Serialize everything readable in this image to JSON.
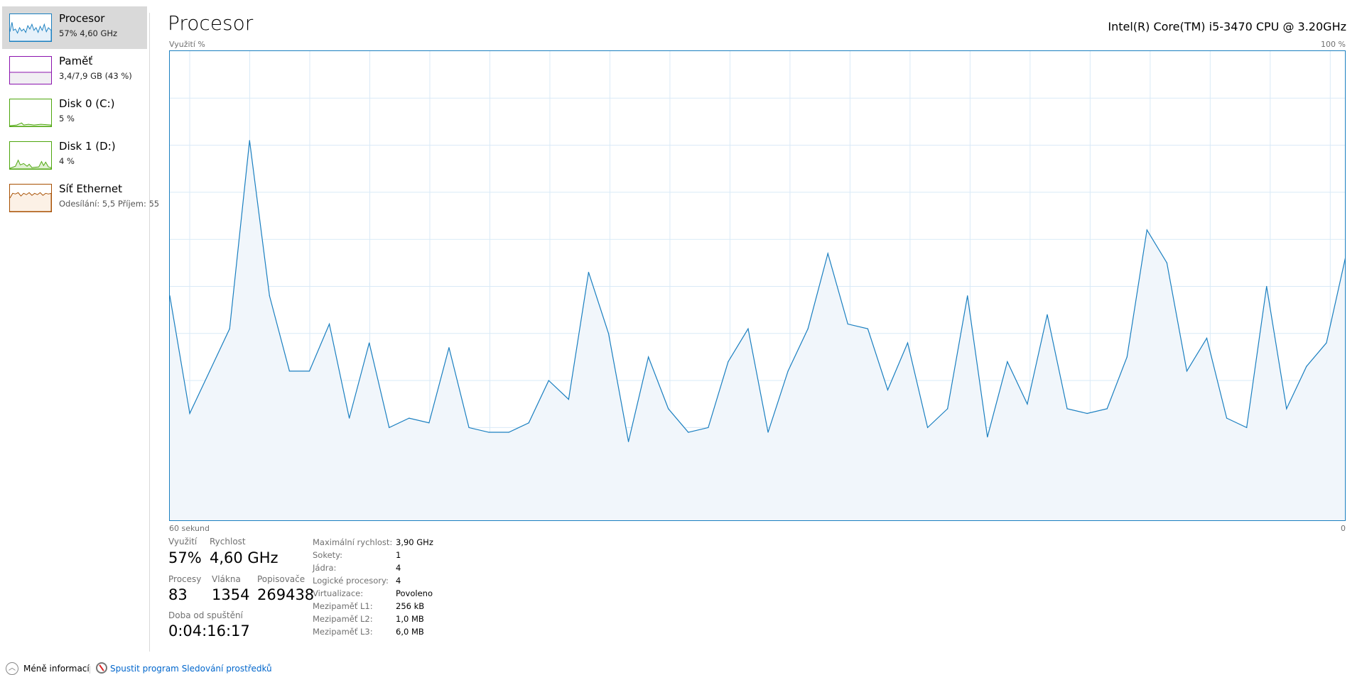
{
  "sidebar": {
    "items": [
      {
        "title": "Procesor",
        "sub": "57% 4,60 GHz",
        "color": "#1a7fc0"
      },
      {
        "title": "Paměť",
        "sub": "3,4/7,9 GB (43 %)",
        "color": "#8b12ae"
      },
      {
        "title": "Disk 0 (C:)",
        "sub": "5 %",
        "color": "#4da60c"
      },
      {
        "title": "Disk 1 (D:)",
        "sub": "4 %",
        "color": "#4da60c"
      },
      {
        "title": "Síť Ethernet",
        "sub": "Odesílání: 5,5 Příjem: 55",
        "color": "#a74f01"
      }
    ]
  },
  "header": {
    "title": "Procesor",
    "cpu_name": "Intel(R) Core(TM) i5-3470 CPU @ 3.20GHz"
  },
  "chart_data": {
    "type": "area",
    "ylabel": "Využití %",
    "ymax_label": "100 %",
    "xlabel_left": "60 sekund",
    "xlabel_right": "0",
    "ylim": [
      0,
      100
    ],
    "values": [
      48,
      23,
      32,
      41,
      81,
      48,
      32,
      32,
      42,
      22,
      38,
      20,
      22,
      21,
      37,
      20,
      19,
      19,
      21,
      30,
      26,
      53,
      40,
      17,
      35,
      24,
      19,
      20,
      34,
      41,
      19,
      32,
      41,
      57,
      42,
      41,
      28,
      38,
      20,
      24,
      48,
      18,
      34,
      25,
      44,
      24,
      23,
      24,
      35,
      62,
      55,
      32,
      39,
      22,
      20,
      50,
      24,
      33,
      38,
      57
    ]
  },
  "stats": {
    "util_label": "Využití",
    "util": "57%",
    "speed_label": "Rychlost",
    "speed": "4,60 GHz",
    "proc_label": "Procesy",
    "proc": "83",
    "threads_label": "Vlákna",
    "threads": "1354",
    "handles_label": "Popisovače",
    "handles": "269438",
    "uptime_label": "Doba od spuštění",
    "uptime": "0:04:16:17",
    "details": [
      {
        "label": "Maximální rychlost:",
        "value": "3,90 GHz"
      },
      {
        "label": "Sokety:",
        "value": "1"
      },
      {
        "label": "Jádra:",
        "value": "4"
      },
      {
        "label": "Logické procesory:",
        "value": "4"
      },
      {
        "label": "Virtualizace:",
        "value": "Povoleno"
      },
      {
        "label": "Mezipaměť L1:",
        "value": "256 kB"
      },
      {
        "label": "Mezipaměť L2:",
        "value": "1,0 MB"
      },
      {
        "label": "Mezipaměť L3:",
        "value": "6,0 MB"
      }
    ]
  },
  "footer": {
    "less": "Méně informací",
    "monitor": "Spustit program Sledování prostředků"
  }
}
